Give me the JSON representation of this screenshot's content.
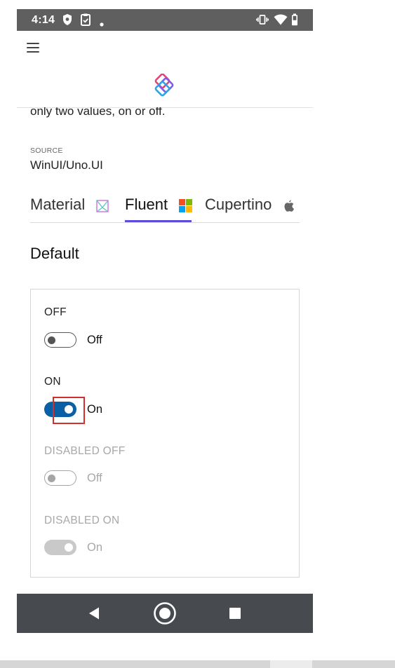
{
  "status_bar": {
    "time": "4:14",
    "left_icons": [
      "shield-icon",
      "clipboard-icon",
      "dot-icon"
    ],
    "right_icons": [
      "vibrate-icon",
      "wifi-icon",
      "battery-icon"
    ]
  },
  "app_bar": {
    "menu_icon": "hamburger-icon",
    "logo_icon": "uno-platform-logo-icon"
  },
  "content": {
    "description_tail": "only two values, on or off.",
    "source_label": "SOURCE",
    "source_value": "WinUI/Uno.UI",
    "tabs": [
      {
        "label": "Material",
        "icon": "material-logo-icon",
        "active": false
      },
      {
        "label": "Fluent",
        "icon": "windows-logo-icon",
        "active": true
      },
      {
        "label": "Cupertino",
        "icon": "apple-logo-icon",
        "active": false
      }
    ],
    "section_title": "Default",
    "toggles": [
      {
        "header": "OFF",
        "state_label": "Off",
        "state": "off",
        "disabled": false
      },
      {
        "header": "ON",
        "state_label": "On",
        "state": "on",
        "disabled": false
      },
      {
        "header": "DISABLED OFF",
        "state_label": "Off",
        "state": "off",
        "disabled": true
      },
      {
        "header": "DISABLED ON",
        "state_label": "On",
        "state": "on",
        "disabled": true
      }
    ]
  },
  "nav_bar": {
    "back_icon": "back-triangle-icon",
    "home_icon": "home-circle-icon",
    "recents_icon": "recents-square-icon"
  },
  "colors": {
    "accent_toggle_on": "#0b5fa5",
    "tab_indicator": "#5b4fd8",
    "status_bar": "#5f5f5f",
    "nav_bar": "#474b50",
    "highlight": "#d32f2f"
  }
}
